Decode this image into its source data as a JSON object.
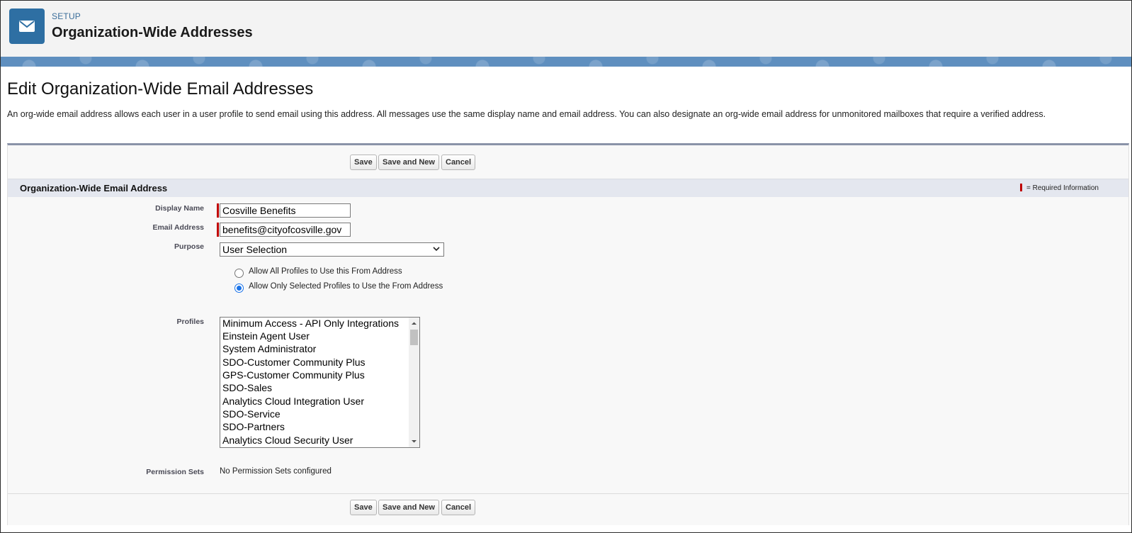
{
  "header": {
    "setup_label": "SETUP",
    "title": "Organization-Wide Addresses",
    "icon": "envelope-icon"
  },
  "page": {
    "title": "Edit Organization-Wide Email Addresses",
    "description": "An org-wide email address allows each user in a user profile to send email using this address. All messages use the same display name and email address. You can also designate an org-wide email address for unmonitored mailboxes that require a verified address."
  },
  "buttons": {
    "save": "Save",
    "save_and_new": "Save and New",
    "cancel": "Cancel"
  },
  "section": {
    "title": "Organization-Wide Email Address",
    "required_legend": "= Required Information"
  },
  "form": {
    "display_name": {
      "label": "Display Name",
      "value": "Cosville Benefits"
    },
    "email_address": {
      "label": "Email Address",
      "value": "benefits@cityofcosville.gov"
    },
    "purpose": {
      "label": "Purpose",
      "value": "User Selection"
    },
    "radios": [
      {
        "label": "Allow All Profiles to Use this From Address",
        "checked": false
      },
      {
        "label": "Allow Only Selected Profiles to Use the From Address",
        "checked": true
      }
    ],
    "profiles": {
      "label": "Profiles",
      "options": [
        "Minimum Access - API Only Integrations",
        "Einstein Agent User",
        "System Administrator",
        "SDO-Customer Community Plus",
        "GPS-Customer Community Plus",
        "SDO-Sales",
        "Analytics Cloud Integration User",
        "SDO-Service",
        "SDO-Partners",
        "Analytics Cloud Security User"
      ]
    },
    "permission_sets": {
      "label": "Permission Sets",
      "value": "No Permission Sets configured"
    }
  },
  "colors": {
    "header_icon_bg": "#2e6fa3",
    "required_marker": "#c00000",
    "radio_accent": "#1a73e8",
    "banner": "#5f8fbf"
  }
}
